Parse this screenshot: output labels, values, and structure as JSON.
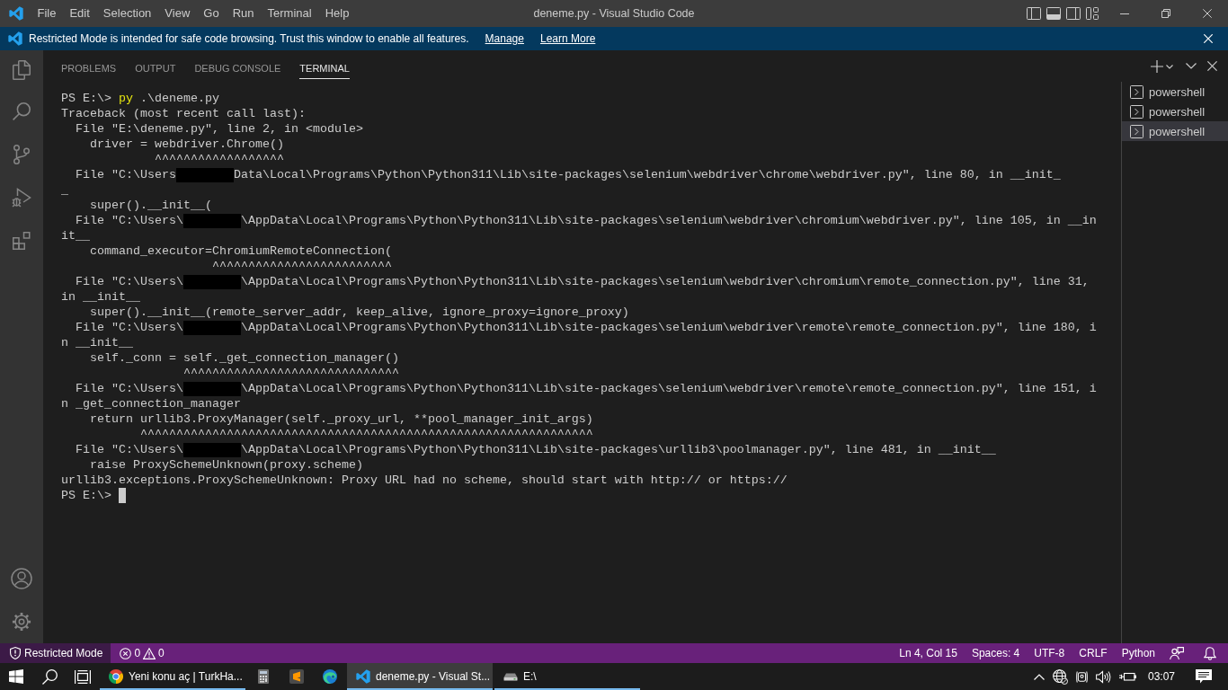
{
  "title_bar": {
    "menu": [
      "File",
      "Edit",
      "Selection",
      "View",
      "Go",
      "Run",
      "Terminal",
      "Help"
    ],
    "title": "deneme.py - Visual Studio Code"
  },
  "banner": {
    "message": "Restricted Mode is intended for safe code browsing. Trust this window to enable all features.",
    "links": [
      "Manage",
      "Learn More"
    ]
  },
  "panel": {
    "tabs": [
      {
        "label": "PROBLEMS",
        "selected": false
      },
      {
        "label": "OUTPUT",
        "selected": false
      },
      {
        "label": "DEBUG CONSOLE",
        "selected": false
      },
      {
        "label": "TERMINAL",
        "selected": true
      }
    ],
    "terminal": {
      "lines": [
        [
          {
            "kind": "text",
            "text": "PS E:\\> "
          },
          {
            "kind": "command",
            "text": "py"
          },
          {
            "kind": "text",
            "text": " .\\deneme.py"
          }
        ],
        [
          {
            "kind": "text",
            "text": "Traceback (most recent call last):"
          }
        ],
        [
          {
            "kind": "text",
            "text": "  File \"E:\\deneme.py\", line 2, in <module>"
          }
        ],
        [
          {
            "kind": "text",
            "text": "    driver = webdriver.Chrome()"
          }
        ],
        [
          {
            "kind": "text",
            "text": "             ^^^^^^^^^^^^^^^^^^"
          }
        ],
        [
          {
            "kind": "text",
            "text": "  File \"C:\\Users"
          },
          {
            "kind": "redaction"
          },
          {
            "kind": "text",
            "text": "Data\\Local\\Programs\\Python\\Python311\\Lib\\site-packages\\selenium\\webdriver\\chrome\\webdriver.py\", line 80, in __init_"
          }
        ],
        [
          {
            "kind": "text",
            "text": "_"
          }
        ],
        [
          {
            "kind": "text",
            "text": "    super().__init__("
          }
        ],
        [
          {
            "kind": "text",
            "text": "  File \"C:\\Users\\"
          },
          {
            "kind": "redaction"
          },
          {
            "kind": "text",
            "text": "\\AppData\\Local\\Programs\\Python\\Python311\\Lib\\site-packages\\selenium\\webdriver\\chromium\\webdriver.py\", line 105, in __in"
          }
        ],
        [
          {
            "kind": "text",
            "text": "it__"
          }
        ],
        [
          {
            "kind": "text",
            "text": "    command_executor=ChromiumRemoteConnection("
          }
        ],
        [
          {
            "kind": "text",
            "text": "                     ^^^^^^^^^^^^^^^^^^^^^^^^^"
          }
        ],
        [
          {
            "kind": "text",
            "text": "  File \"C:\\Users\\"
          },
          {
            "kind": "redaction"
          },
          {
            "kind": "text",
            "text": "\\AppData\\Local\\Programs\\Python\\Python311\\Lib\\site-packages\\selenium\\webdriver\\chromium\\remote_connection.py\", line 31,"
          }
        ],
        [
          {
            "kind": "text",
            "text": "in __init__"
          }
        ],
        [
          {
            "kind": "text",
            "text": "    super().__init__(remote_server_addr, keep_alive, ignore_proxy=ignore_proxy)"
          }
        ],
        [
          {
            "kind": "text",
            "text": "  File \"C:\\Users\\"
          },
          {
            "kind": "redaction"
          },
          {
            "kind": "text",
            "text": "\\AppData\\Local\\Programs\\Python\\Python311\\Lib\\site-packages\\selenium\\webdriver\\remote\\remote_connection.py\", line 180, i"
          }
        ],
        [
          {
            "kind": "text",
            "text": "n __init__"
          }
        ],
        [
          {
            "kind": "text",
            "text": "    self._conn = self._get_connection_manager()"
          }
        ],
        [
          {
            "kind": "text",
            "text": "                 ^^^^^^^^^^^^^^^^^^^^^^^^^^^^^^"
          }
        ],
        [
          {
            "kind": "text",
            "text": "  File \"C:\\Users\\"
          },
          {
            "kind": "redaction"
          },
          {
            "kind": "text",
            "text": "\\AppData\\Local\\Programs\\Python\\Python311\\Lib\\site-packages\\selenium\\webdriver\\remote\\remote_connection.py\", line 151, i"
          }
        ],
        [
          {
            "kind": "text",
            "text": "n _get_connection_manager"
          }
        ],
        [
          {
            "kind": "text",
            "text": "    return urllib3.ProxyManager(self._proxy_url, **pool_manager_init_args)"
          }
        ],
        [
          {
            "kind": "text",
            "text": "           ^^^^^^^^^^^^^^^^^^^^^^^^^^^^^^^^^^^^^^^^^^^^^^^^^^^^^^^^^^^^^^^"
          }
        ],
        [
          {
            "kind": "text",
            "text": "  File \"C:\\Users\\"
          },
          {
            "kind": "redaction"
          },
          {
            "kind": "text",
            "text": "\\AppData\\Local\\Programs\\Python\\Python311\\Lib\\site-packages\\urllib3\\poolmanager.py\", line 481, in __init__"
          }
        ],
        [
          {
            "kind": "text",
            "text": "    raise ProxySchemeUnknown(proxy.scheme)"
          }
        ],
        [
          {
            "kind": "text",
            "text": "urllib3.exceptions.ProxySchemeUnknown: Proxy URL had no scheme, should start with http:// or https://"
          }
        ],
        [
          {
            "kind": "text",
            "text": "PS E:\\> "
          },
          {
            "kind": "cursor"
          }
        ]
      ]
    },
    "terminal_list": [
      {
        "label": "powershell",
        "selected": false
      },
      {
        "label": "powershell",
        "selected": false
      },
      {
        "label": "powershell",
        "selected": true
      }
    ]
  },
  "status_bar": {
    "restricted_mode": "Restricted Mode",
    "errors": "0",
    "warnings": "0",
    "items": [
      "Ln 4, Col 15",
      "Spaces: 4",
      "UTF-8",
      "CRLF",
      "Python"
    ]
  },
  "taskbar": {
    "items": [
      {
        "kind": "chrome",
        "label": "Yeni konu aç | TurkHa...",
        "selected": false
      },
      {
        "kind": "calculator",
        "selected": false
      },
      {
        "kind": "sublime",
        "selected": false
      },
      {
        "kind": "edge",
        "selected": false
      },
      {
        "kind": "vscode",
        "label": "deneme.py - Visual St...",
        "selected": true
      },
      {
        "kind": "drive",
        "label": "E:\\",
        "selected": false
      }
    ],
    "clock": "03:07"
  }
}
